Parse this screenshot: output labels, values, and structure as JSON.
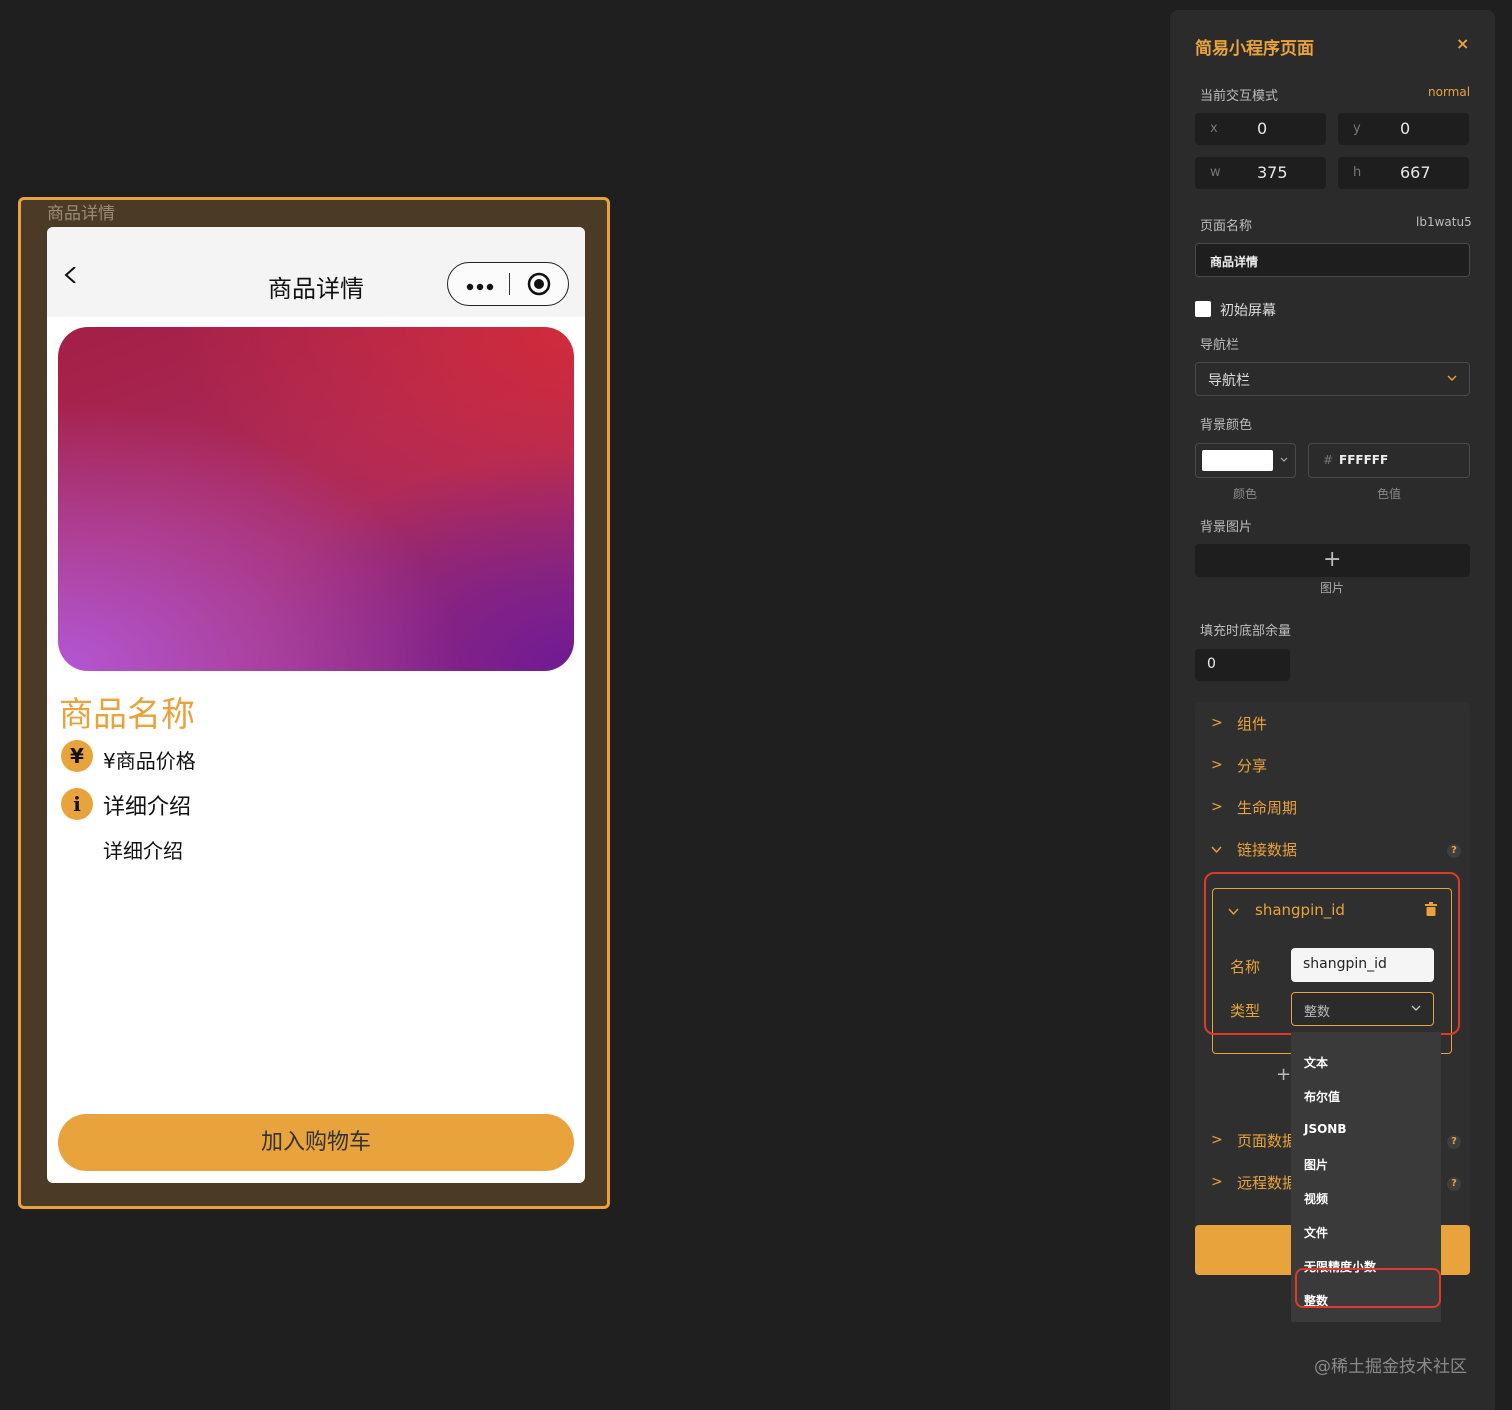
{
  "canvas": {
    "frame_title": "商品详情",
    "navbar_title": "商品详情",
    "product_name": "商品名称",
    "price_text": "¥商品价格",
    "price_icon": "¥",
    "detail_icon": "i",
    "detail_title": "详细介绍",
    "detail_body": "详细介绍",
    "cart_button": "加入购物车",
    "accent_color": "#e8a33d"
  },
  "panel": {
    "title": "简易小程序页面",
    "close": "×",
    "mode_label": "当前交互模式",
    "mode_value": "normal",
    "coords": {
      "x_label": "x",
      "x": "0",
      "y_label": "y",
      "y": "0",
      "w_label": "w",
      "w": "375",
      "h_label": "h",
      "h": "667"
    },
    "page_name_label": "页面名称",
    "page_id": "lb1watu5",
    "page_name_value": "商品详情",
    "initial_screen_label": "初始屏幕",
    "navbar_label": "导航栏",
    "navbar_select": "导航栏",
    "bg_color_label": "背景颜色",
    "bg_color_hash": "#",
    "bg_color_value": "FFFFFF",
    "color_caption": "颜色",
    "value_caption": "色值",
    "bg_image_label": "背景图片",
    "bg_image_plus": "+",
    "image_caption": "图片",
    "bottom_fill_label": "填充时底部余量",
    "bottom_fill_value": "0",
    "sections": {
      "components": "组件",
      "share": "分享",
      "lifecycle": "生命周期",
      "link_data": "链接数据",
      "page_data": "页面数据",
      "remote_data": "远程数据"
    },
    "help": "?",
    "link_item": {
      "name": "shangpin_id",
      "name_label": "名称",
      "name_value": "shangpin_id",
      "type_label": "类型",
      "type_value": "整数"
    },
    "add_plus": "+",
    "type_options": [
      "文本",
      "布尔值",
      "JSONB",
      "图片",
      "视频",
      "文件",
      "无限精度小数",
      "整数"
    ],
    "selected_option": "整数"
  },
  "watermark": "@稀土掘金技术社区"
}
